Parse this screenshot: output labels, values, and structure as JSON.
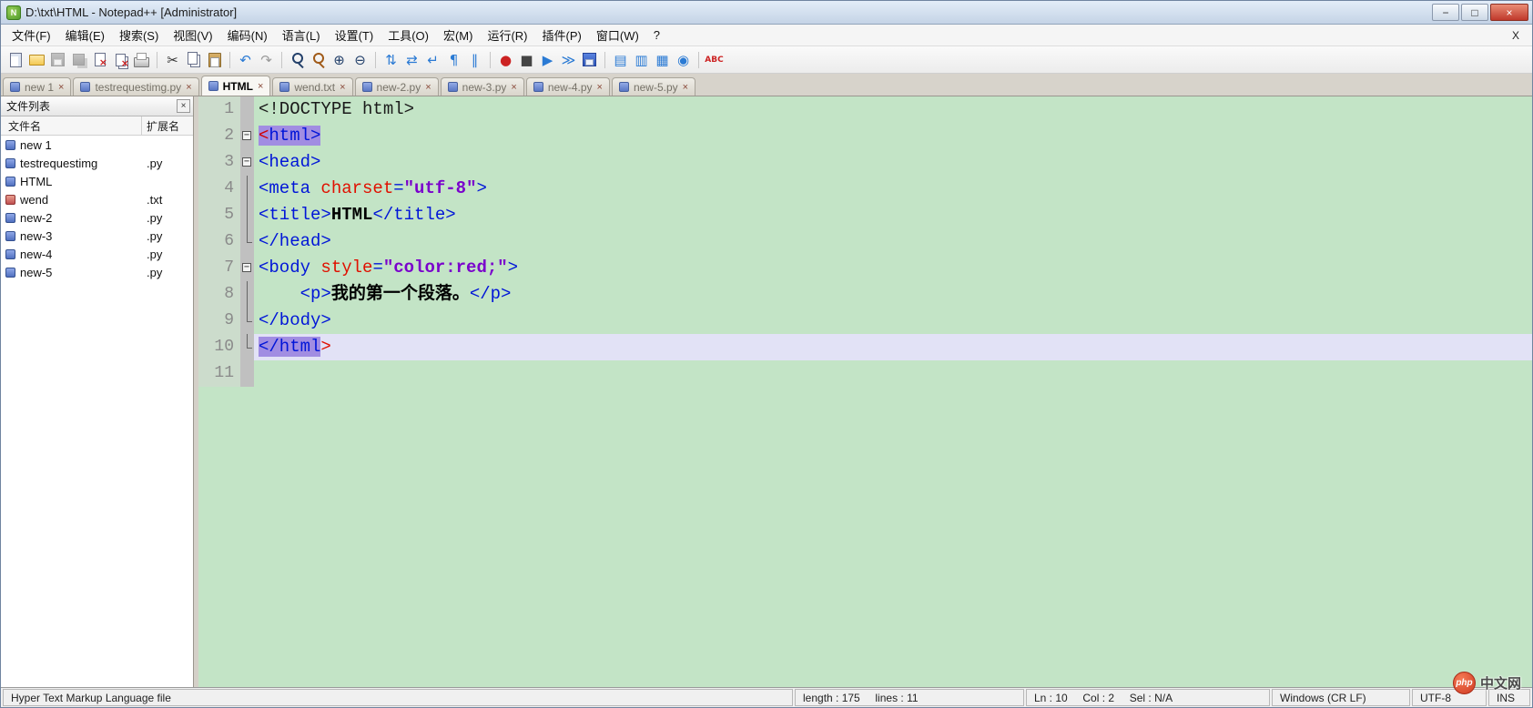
{
  "window": {
    "title": "D:\\txt\\HTML - Notepad++ [Administrator]",
    "app_icon": "N",
    "controls": {
      "minimize": "−",
      "maximize": "□",
      "close": "×"
    }
  },
  "menu": {
    "items": [
      "文件(F)",
      "编辑(E)",
      "搜索(S)",
      "视图(V)",
      "编码(N)",
      "语言(L)",
      "设置(T)",
      "工具(O)",
      "宏(M)",
      "运行(R)",
      "插件(P)",
      "窗口(W)",
      "?"
    ],
    "close_label": "X"
  },
  "toolbar": [
    {
      "name": "new-file-icon",
      "cls": "i-new"
    },
    {
      "name": "open-file-icon",
      "cls": "i-open"
    },
    {
      "name": "save-icon",
      "cls": "i-save dis"
    },
    {
      "name": "save-all-icon",
      "cls": "i-saveall dis"
    },
    {
      "name": "close-file-icon",
      "cls": "i-close"
    },
    {
      "name": "close-all-icon",
      "cls": "i-closeall"
    },
    {
      "name": "print-icon",
      "cls": "i-print"
    },
    {
      "name": "separator"
    },
    {
      "name": "cut-icon",
      "glyph": "✂",
      "color": "#333333"
    },
    {
      "name": "copy-icon",
      "cls": "i-copy"
    },
    {
      "name": "paste-icon",
      "cls": "i-paste"
    },
    {
      "name": "separator"
    },
    {
      "name": "undo-icon",
      "glyph": "↶",
      "color": "#2a7ad4"
    },
    {
      "name": "redo-icon",
      "glyph": "↷",
      "color": "#9a9a9a"
    },
    {
      "name": "separator"
    },
    {
      "name": "find-icon",
      "cls": "i-find"
    },
    {
      "name": "replace-icon",
      "cls": "i-replace"
    },
    {
      "name": "zoom-in-icon",
      "glyph": "⊕",
      "color": "#23406a"
    },
    {
      "name": "zoom-out-icon",
      "glyph": "⊖",
      "color": "#23406a"
    },
    {
      "name": "separator"
    },
    {
      "name": "sync-vertical-icon",
      "glyph": "⇅",
      "color": "#2a7ad4"
    },
    {
      "name": "sync-horizontal-icon",
      "glyph": "⇄",
      "color": "#2a7ad4"
    },
    {
      "name": "word-wrap-icon",
      "glyph": "↵",
      "color": "#2a7ad4"
    },
    {
      "name": "show-all-chars-icon",
      "glyph": "¶",
      "color": "#2a7ad4"
    },
    {
      "name": "indent-guide-icon",
      "glyph": "∥",
      "color": "#2a7ad4"
    },
    {
      "name": "separator"
    },
    {
      "name": "record-macro-icon",
      "glyph": "●",
      "color": "#cc2222"
    },
    {
      "name": "stop-macro-icon",
      "glyph": "■",
      "color": "#444444"
    },
    {
      "name": "play-macro-icon",
      "glyph": "▶",
      "color": "#2a7ad4"
    },
    {
      "name": "run-macro-multiple-icon",
      "glyph": "≫",
      "color": "#2a7ad4"
    },
    {
      "name": "save-macro-icon",
      "cls": "i-save"
    },
    {
      "name": "separator"
    },
    {
      "name": "function-list-icon",
      "glyph": "▤",
      "color": "#2a7ad4"
    },
    {
      "name": "document-map-icon",
      "glyph": "▥",
      "color": "#2a7ad4"
    },
    {
      "name": "folder-workspace-icon",
      "glyph": "▦",
      "color": "#2a7ad4"
    },
    {
      "name": "document-monitor-icon",
      "glyph": "◉",
      "color": "#2a7ad4"
    },
    {
      "name": "separator"
    },
    {
      "name": "spell-check-icon",
      "cls": "i-abc",
      "glyph": "ABC"
    }
  ],
  "file_panel": {
    "title": "文件列表",
    "close": "×",
    "columns": [
      "文件名",
      "扩展名"
    ],
    "files": [
      {
        "name": "new 1",
        "ext": "",
        "icon": "blue"
      },
      {
        "name": "testrequestimg",
        "ext": ".py",
        "icon": "blue"
      },
      {
        "name": "HTML",
        "ext": "",
        "icon": "blue"
      },
      {
        "name": "wend",
        "ext": ".txt",
        "icon": "red"
      },
      {
        "name": "new-2",
        "ext": ".py",
        "icon": "blue"
      },
      {
        "name": "new-3",
        "ext": ".py",
        "icon": "blue"
      },
      {
        "name": "new-4",
        "ext": ".py",
        "icon": "blue"
      },
      {
        "name": "new-5",
        "ext": ".py",
        "icon": "blue"
      }
    ]
  },
  "tabs": [
    {
      "label": "new 1",
      "close": "×",
      "active": false
    },
    {
      "label": "testrequestimg.py",
      "close": "×",
      "active": false
    },
    {
      "label": "HTML",
      "close": "×",
      "active": true
    },
    {
      "label": "wend.txt",
      "close": "×",
      "active": false
    },
    {
      "label": "new-2.py",
      "close": "×",
      "active": false
    },
    {
      "label": "new-3.py",
      "close": "×",
      "active": false
    },
    {
      "label": "new-4.py",
      "close": "×",
      "active": false
    },
    {
      "label": "new-5.py",
      "close": "×",
      "active": false
    }
  ],
  "editor": {
    "colors": {
      "background": "#c3e4c6",
      "current_line": "#e2e2f6",
      "tag_match_highlight": "#a18de2",
      "tag": "#0015d8",
      "attribute": "#e01000",
      "value": "#7a00cc"
    },
    "lines": [
      {
        "n": "1",
        "f": "",
        "t": [
          [
            "<!DOCTYPE html>",
            "doc"
          ]
        ]
      },
      {
        "n": "2",
        "f": "box",
        "t": [
          [
            "<",
            "sel-red"
          ],
          [
            "html>",
            "sel-tag"
          ]
        ]
      },
      {
        "n": "3",
        "f": "box",
        "t": [
          [
            "<head>",
            "tag"
          ]
        ]
      },
      {
        "n": "4",
        "f": "line",
        "t": [
          [
            "<meta ",
            "tag"
          ],
          [
            "charset",
            "attr"
          ],
          [
            "=",
            "tag"
          ],
          [
            "\"utf-8\"",
            "val"
          ],
          [
            ">",
            "tag"
          ]
        ]
      },
      {
        "n": "5",
        "f": "line",
        "t": [
          [
            "<title>",
            "tag"
          ],
          [
            "HTML",
            "txt"
          ],
          [
            "</title>",
            "tag"
          ]
        ]
      },
      {
        "n": "6",
        "f": "end",
        "t": [
          [
            "</head>",
            "tag"
          ]
        ]
      },
      {
        "n": "7",
        "f": "box",
        "t": [
          [
            "<body ",
            "tag"
          ],
          [
            "style",
            "attr"
          ],
          [
            "=",
            "tag"
          ],
          [
            "\"color:red;\"",
            "val"
          ],
          [
            ">",
            "tag"
          ]
        ]
      },
      {
        "n": "8",
        "f": "line",
        "t": [
          [
            "    ",
            "plain"
          ],
          [
            "<p>",
            "tag"
          ],
          [
            "我的第一个段落。",
            "txt"
          ],
          [
            "</p>",
            "tag"
          ]
        ]
      },
      {
        "n": "9",
        "f": "end",
        "t": [
          [
            "</body>",
            "tag"
          ]
        ]
      },
      {
        "n": "10",
        "f": "end",
        "cur": true,
        "t": [
          [
            "</html",
            "sel-tag"
          ],
          [
            ">",
            "red"
          ]
        ]
      },
      {
        "n": "11",
        "f": "",
        "t": []
      }
    ]
  },
  "status": {
    "sections": [
      {
        "name": "status-doc-type",
        "text": "Hyper Text Markup Language file"
      },
      {
        "name": "status-length",
        "text": "length : 175     lines : 11"
      },
      {
        "name": "status-position",
        "text": "Ln : 10     Col : 2     Sel : N/A"
      },
      {
        "name": "status-eol",
        "text": "Windows (CR LF)"
      },
      {
        "name": "status-encoding",
        "text": "UTF-8"
      },
      {
        "name": "status-insert",
        "text": "INS"
      }
    ]
  },
  "watermark": {
    "logo": "php",
    "text": "中文网"
  }
}
